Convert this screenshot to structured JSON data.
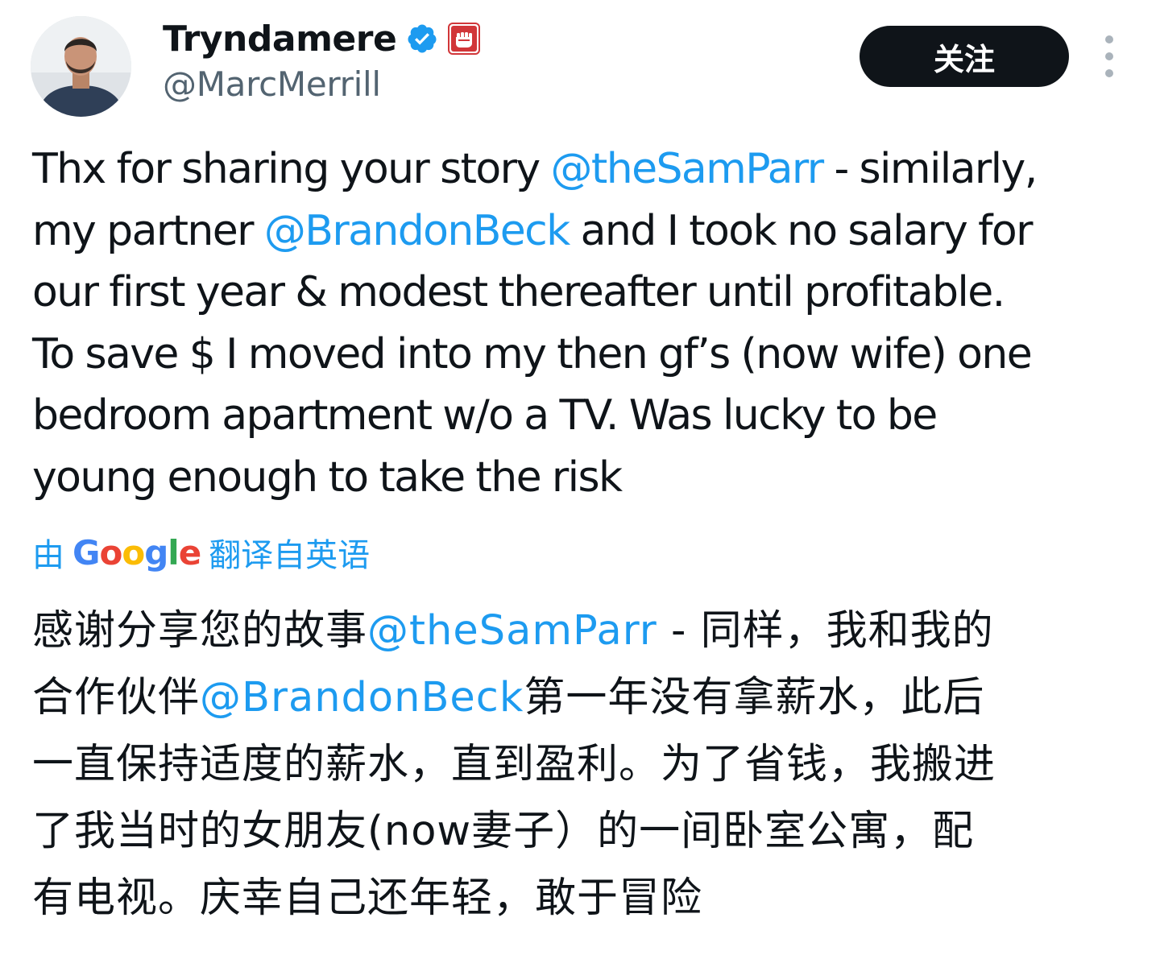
{
  "user": {
    "display_name": "Tryndamere",
    "handle": "@MarcMerrill",
    "verified_icon": "verified-badge-icon",
    "affiliate_icon": "riot-games-fist-logo-icon"
  },
  "header": {
    "follow_label": "关注",
    "more_icon": "more-vertical-icon"
  },
  "tweet": {
    "lines": [
      [
        {
          "text": "Thx for sharing your story "
        },
        {
          "text": "@theSamParr",
          "mention": true
        },
        {
          "text": " - similarly,"
        }
      ],
      [
        {
          "text": "my partner "
        },
        {
          "text": "@BrandonBeck",
          "mention": true
        },
        {
          "text": " and I took no salary for"
        }
      ],
      [
        {
          "text": "our first year & modest thereafter until profitable."
        }
      ],
      [
        {
          "text": "To save $ I moved into my then gf’s (now wife) one"
        }
      ],
      [
        {
          "text": "bedroom apartment w/o a TV. Was lucky to be"
        }
      ],
      [
        {
          "text": "young enough to take the risk"
        }
      ]
    ]
  },
  "translation": {
    "prefix": "由",
    "provider": "Google",
    "suffix": "翻译自英语",
    "lines": [
      [
        {
          "text": "感谢分享您的故事"
        },
        {
          "text": "@theSamParr",
          "mention": true
        },
        {
          "text": " - 同样，我和我的"
        }
      ],
      [
        {
          "text": "合作伙伴"
        },
        {
          "text": "@BrandonBeck",
          "mention": true
        },
        {
          "text": "第一年没有拿薪水，此后"
        }
      ],
      [
        {
          "text": "一直保持适度的薪水，直到盈利。为了省钱，我搬进"
        }
      ],
      [
        {
          "text": "了我当时的女朋友(now妻子）的一间卧室公寓，配"
        }
      ],
      [
        {
          "text": "有电视。庆幸自己还年轻，敢于冒险"
        }
      ]
    ]
  },
  "colors": {
    "text": "#0f1419",
    "secondary": "#536471",
    "link": "#1d9bf0",
    "button_bg": "#0f1419",
    "verified": "#1d9bf0",
    "affiliate_bg": "#d13639",
    "google_blue": "#4285F4",
    "google_red": "#EA4335",
    "google_yellow": "#FBBC05",
    "google_green": "#34A853"
  }
}
